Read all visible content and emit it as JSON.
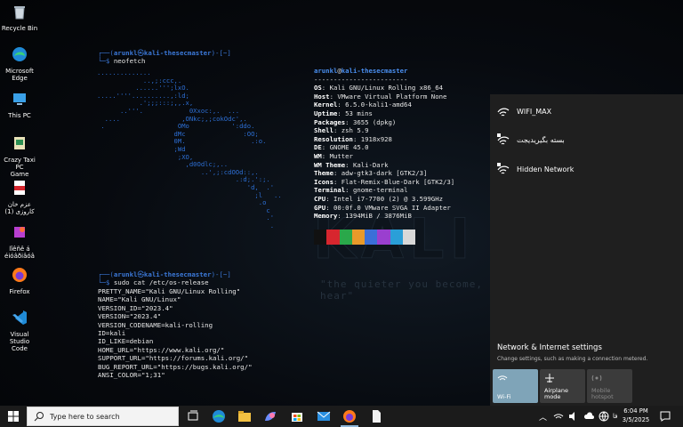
{
  "desktop_icons": [
    {
      "label": "Recycle Bin",
      "icon": "recycle-bin-icon"
    },
    {
      "label": "Microsoft\nEdge",
      "icon": "edge-icon"
    },
    {
      "label": "This PC",
      "icon": "this-pc-icon"
    },
    {
      "label": "Crazy Taxi PC\nGame",
      "icon": "game-icon"
    },
    {
      "label": "عزم خان\nکاروزی (1)",
      "icon": "pdf-icon"
    },
    {
      "label": "lîêñê á\néióâðiâóâ",
      "icon": "app-icon"
    },
    {
      "label": "Firefox",
      "icon": "firefox-icon"
    },
    {
      "label": "Visual Studio\nCode",
      "icon": "vscode-icon"
    }
  ],
  "terminal": {
    "prompt1": {
      "bracket_open": "┌──(",
      "user": "arunkl",
      "at": "㉿",
      "host": "kali-thesecmaster",
      "bracket_close": ")-[~]",
      "cmd_prefix": "└─$ ",
      "cmd": "neofetch"
    },
    "prompt2": {
      "bracket_open": "┌──(",
      "user": "arunkl",
      "at": "㉿",
      "host": "kali-thesecmaster",
      "bracket_close": ")-[~]",
      "cmd_prefix": "└─$ ",
      "cmd": "sudo cat /etc/os-release"
    },
    "art": "..............\n            ..,;:ccc,.\n          ......''';lxO.\n.....''''..........,:ld;\n           .';;;:::;,,.x,\n      ..'''.            0Xxoc:,.  ...\n  ....                ,ONkc;,;cokOdc',.\n .                   OMo           ':ddo.\n                    dMc               :OO;\n                    0M.                 .:o.\n                    ;Wd\n                     ;XO,\n                       ,d0Odlc;,..\n                           ..',;:cdOOd::,.\n                                    .:d;.':;.\n                                       'd,  .'\n                                         ;l   ..\n                                          .o\n                                            c\n                                            .'\n                                             .",
    "os_release": [
      "PRETTY_NAME=\"Kali GNU/Linux Rolling\"",
      "NAME=\"Kali GNU/Linux\"",
      "VERSION_ID=\"2023.4\"",
      "VERSION=\"2023.4\"",
      "VERSION_CODENAME=kali-rolling",
      "ID=kali",
      "ID_LIKE=debian",
      "HOME_URL=\"https://www.kali.org/\"",
      "SUPPORT_URL=\"https://forums.kali.org/\"",
      "BUG_REPORT_URL=\"https://bugs.kali.org/\"",
      "ANSI_COLOR=\"1;31\""
    ]
  },
  "neofetch": {
    "user": "arunkl",
    "at": "@",
    "host": "kali-thesecmaster",
    "separator": "------------------------",
    "rows": [
      {
        "k": "OS",
        "v": "Kali GNU/Linux Rolling x86_64"
      },
      {
        "k": "Host",
        "v": "VMware Virtual Platform None"
      },
      {
        "k": "Kernel",
        "v": "6.5.0-kali1-amd64"
      },
      {
        "k": "Uptime",
        "v": "53 mins"
      },
      {
        "k": "Packages",
        "v": "3655 (dpkg)"
      },
      {
        "k": "Shell",
        "v": "zsh 5.9"
      },
      {
        "k": "Resolution",
        "v": "1918x928"
      },
      {
        "k": "DE",
        "v": "GNOME 45.0"
      },
      {
        "k": "WM",
        "v": "Mutter"
      },
      {
        "k": "WM Theme",
        "v": "Kali-Dark"
      },
      {
        "k": "Theme",
        "v": "adw-gtk3-dark [GTK2/3]"
      },
      {
        "k": "Icons",
        "v": "Flat-Remix-Blue-Dark [GTK2/3]"
      },
      {
        "k": "Terminal",
        "v": "gnome-terminal"
      },
      {
        "k": "CPU",
        "v": "Intel i7-7700 (2) @ 3.599GHz"
      },
      {
        "k": "GPU",
        "v": "00:0f.0 VMware SVGA II Adapter"
      },
      {
        "k": "Memory",
        "v": "1394MiB / 3876MiB"
      }
    ],
    "swatches": [
      "#111111",
      "#d7262e",
      "#2aa84a",
      "#e89a2a",
      "#3b6fd8",
      "#9a3fcf",
      "#2a9fd8",
      "#d8d8d8",
      "#333333",
      "#ef3b45",
      "#5ccf63",
      "#f2c14a",
      "#5a8cf0",
      "#c062e6",
      "#4cc9f0",
      "#ffffff"
    ]
  },
  "wallpaper": {
    "brand": "KALI",
    "slogan": "\"the quieter you become, the more you are able to hear\""
  },
  "wifi_flyout": {
    "networks": [
      {
        "name": "WIFI_MAX",
        "secured": false
      },
      {
        "name": "بسته بگیریدیجت",
        "secured": true
      },
      {
        "name": "Hidden Network",
        "secured": true
      }
    ],
    "settings_title": "Network & Internet settings",
    "settings_sub": "Change settings, such as making a connection metered.",
    "quick_actions": [
      {
        "label": "Wi-Fi",
        "active": true,
        "icon": "wifi-icon"
      },
      {
        "label": "Airplane mode",
        "active": false,
        "icon": "airplane-icon"
      },
      {
        "label": "Mobile\nhotspot",
        "active": false,
        "disabled": true,
        "icon": "hotspot-icon"
      }
    ]
  },
  "taskbar": {
    "search_placeholder": "Type here to search",
    "apps": [
      "task-view-icon",
      "edge-icon",
      "file-explorer-icon",
      "copilot-icon",
      "store-icon",
      "mail-icon",
      "firefox-icon",
      "file-icon"
    ],
    "tray_lang": "فا",
    "time": "6:04 PM",
    "date": "3/5/2025"
  },
  "colors": {
    "accent": "#3b78d8",
    "flyout_bg": "#1f1f1f",
    "wifi_active": "#7fa4b8",
    "taskbar": "#1b1b1b"
  }
}
